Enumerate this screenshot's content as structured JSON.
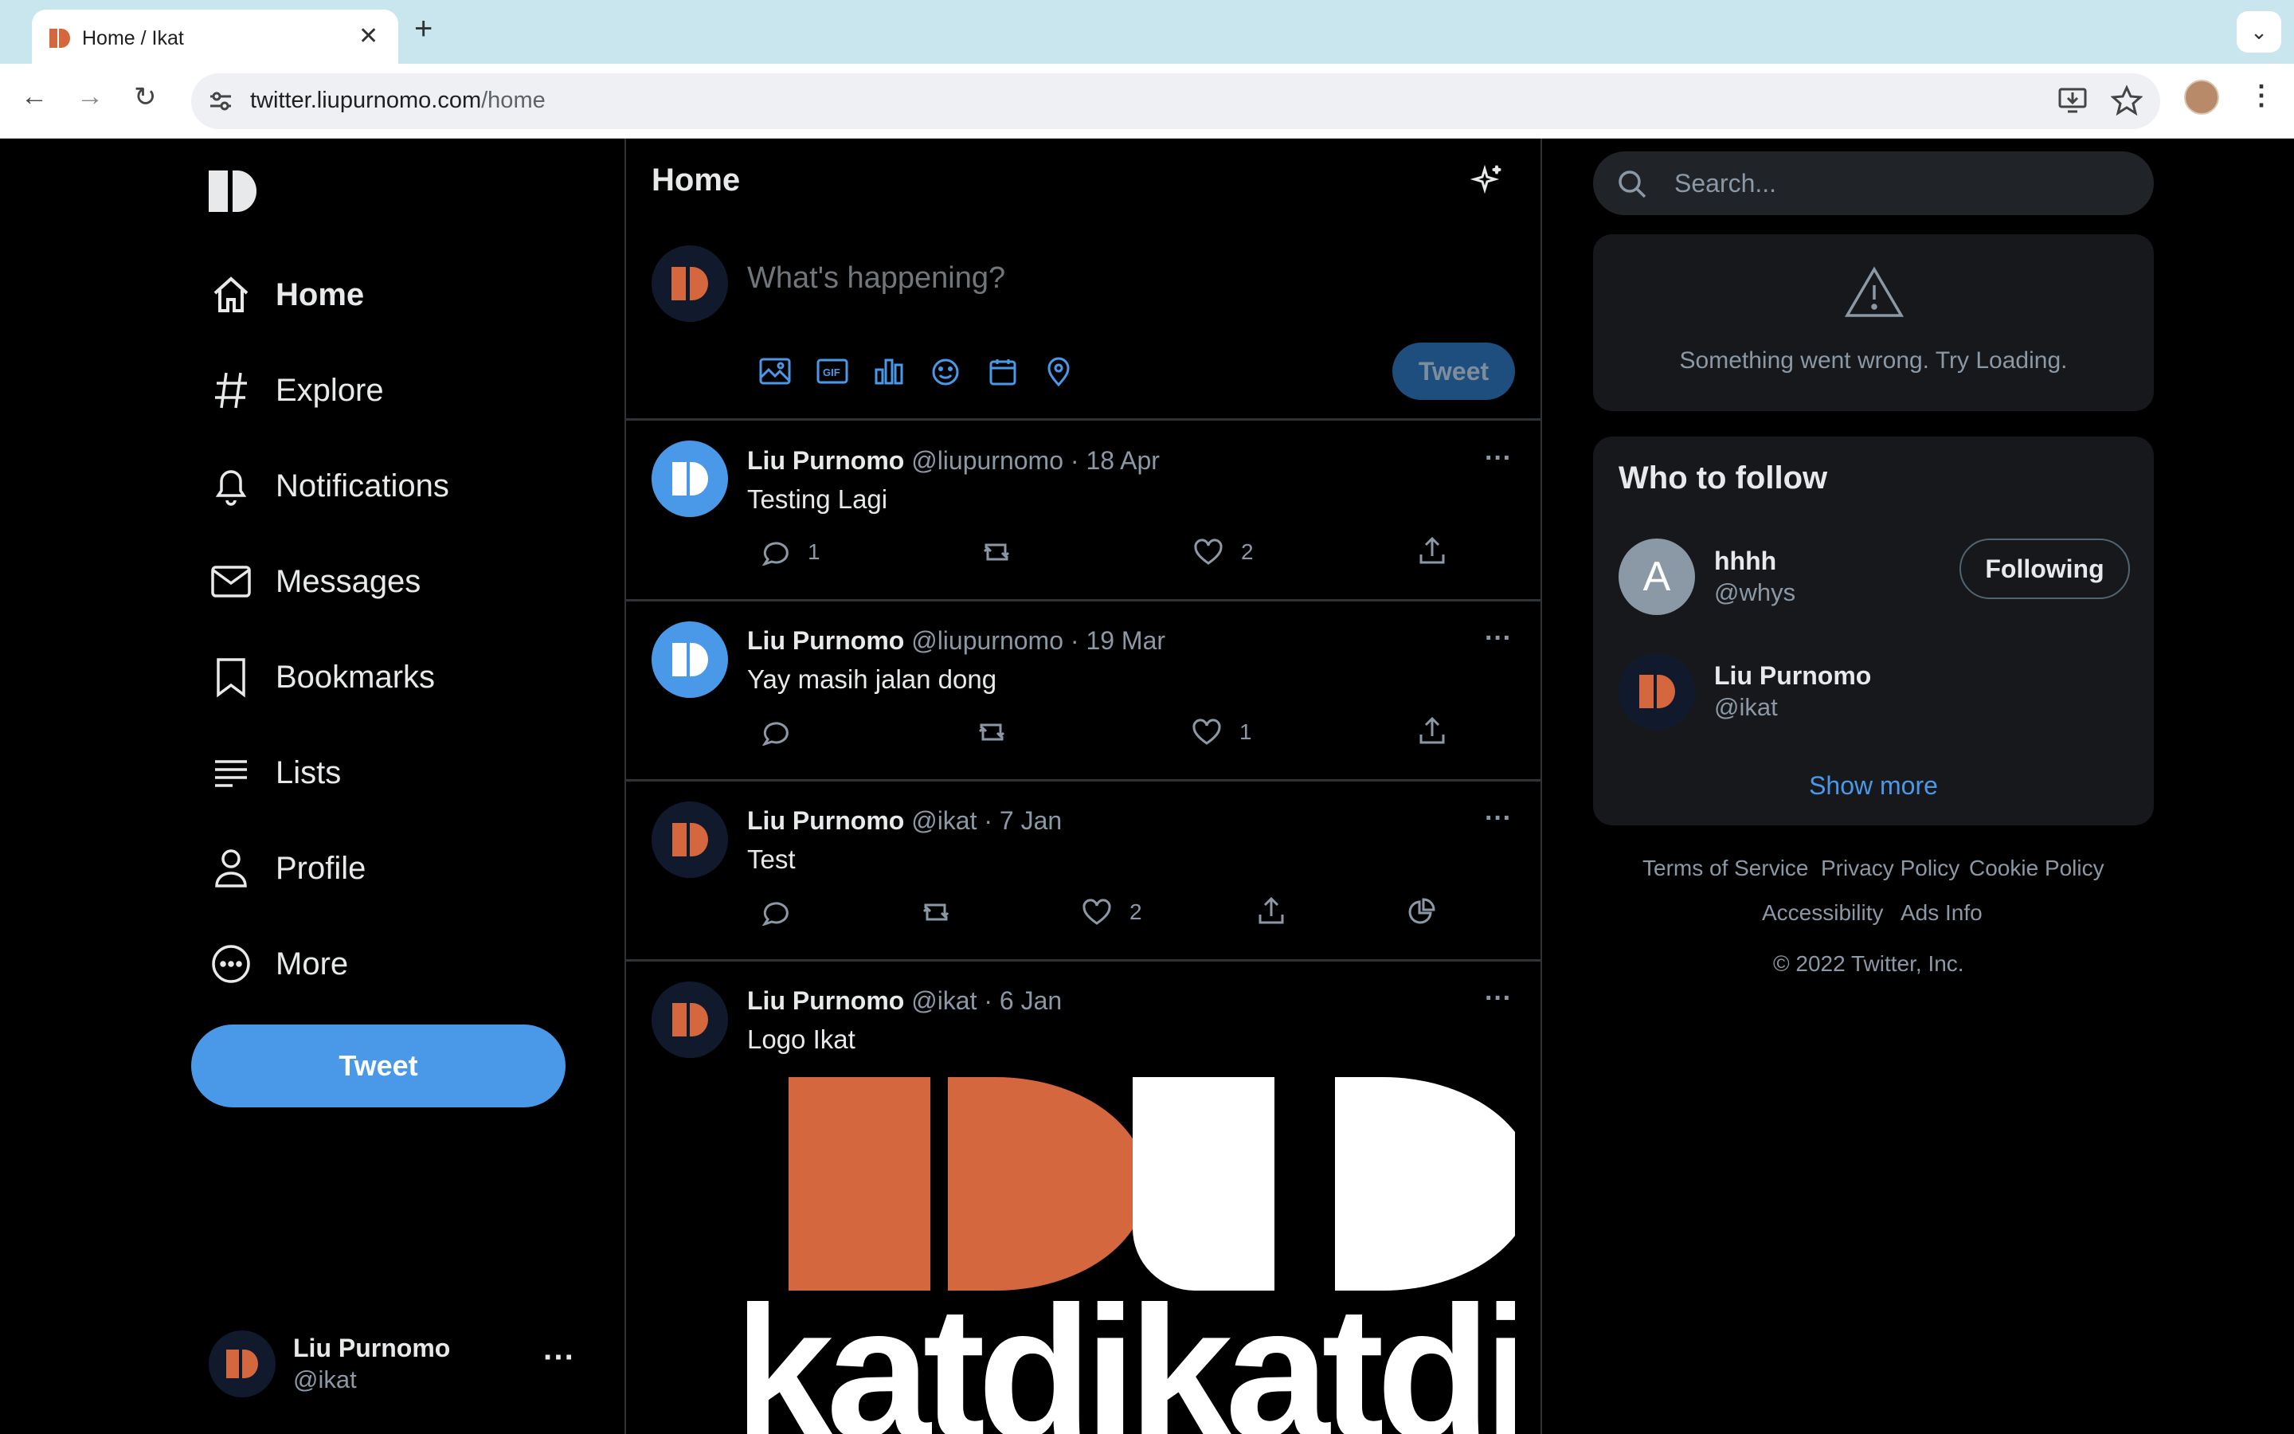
{
  "browser": {
    "tab_title": "Home / Ikat",
    "url_host": "twitter.liupurnomo.com",
    "url_path": "/home"
  },
  "colors": {
    "accent": "#4a99e9",
    "brand_orange": "#d4673e",
    "background": "#000000",
    "muted_text": "#8b98a5"
  },
  "nav": {
    "items": [
      {
        "label": "Home",
        "icon": "home-icon",
        "active": true
      },
      {
        "label": "Explore",
        "icon": "hashtag-icon"
      },
      {
        "label": "Notifications",
        "icon": "bell-icon"
      },
      {
        "label": "Messages",
        "icon": "envelope-icon"
      },
      {
        "label": "Bookmarks",
        "icon": "bookmark-icon"
      },
      {
        "label": "Lists",
        "icon": "list-icon"
      },
      {
        "label": "Profile",
        "icon": "person-icon"
      },
      {
        "label": "More",
        "icon": "more-circle-icon"
      }
    ],
    "tweet_button": "Tweet",
    "account": {
      "name": "Liu Purnomo",
      "handle": "@ikat",
      "menu": "···"
    }
  },
  "center": {
    "title": "Home",
    "composer": {
      "placeholder": "What's happening?",
      "tweet_button": "Tweet"
    },
    "tweets": [
      {
        "name": "Liu Purnomo",
        "handle": "@liupurnomo",
        "date": "· 18 Apr",
        "text": "Testing Lagi",
        "replies": "1",
        "likes": "2",
        "avatar": "blue"
      },
      {
        "name": "Liu Purnomo",
        "handle": "@liupurnomo",
        "date": "· 19 Mar",
        "text": "Yay masih jalan dong",
        "replies": "",
        "likes": "1",
        "avatar": "blue"
      },
      {
        "name": "Liu Purnomo",
        "handle": "@ikat",
        "date": "· 7 Jan",
        "text": "Test",
        "replies": "",
        "likes": "2",
        "avatar": "dark"
      },
      {
        "name": "Liu Purnomo",
        "handle": "@ikat",
        "date": "· 6 Jan",
        "text": "Logo Ikat",
        "avatar": "dark",
        "image_text": "katdikatdi"
      }
    ],
    "more_menu": "···"
  },
  "right": {
    "search_placeholder": "Search...",
    "error_message": "Something went wrong. Try Loading.",
    "who_to_follow": {
      "title": "Who to follow",
      "users": [
        {
          "initial": "A",
          "name": "hhhh",
          "handle": "@whys",
          "button": "Following"
        },
        {
          "name": "Liu Purnomo",
          "handle": "@ikat"
        }
      ],
      "show_more": "Show more"
    },
    "footer": {
      "links": [
        "Terms of Service",
        "Privacy Policy",
        "Cookie Policy",
        "Accessibility",
        "Ads Info"
      ],
      "copyright": "© 2022 Twitter, Inc."
    }
  }
}
